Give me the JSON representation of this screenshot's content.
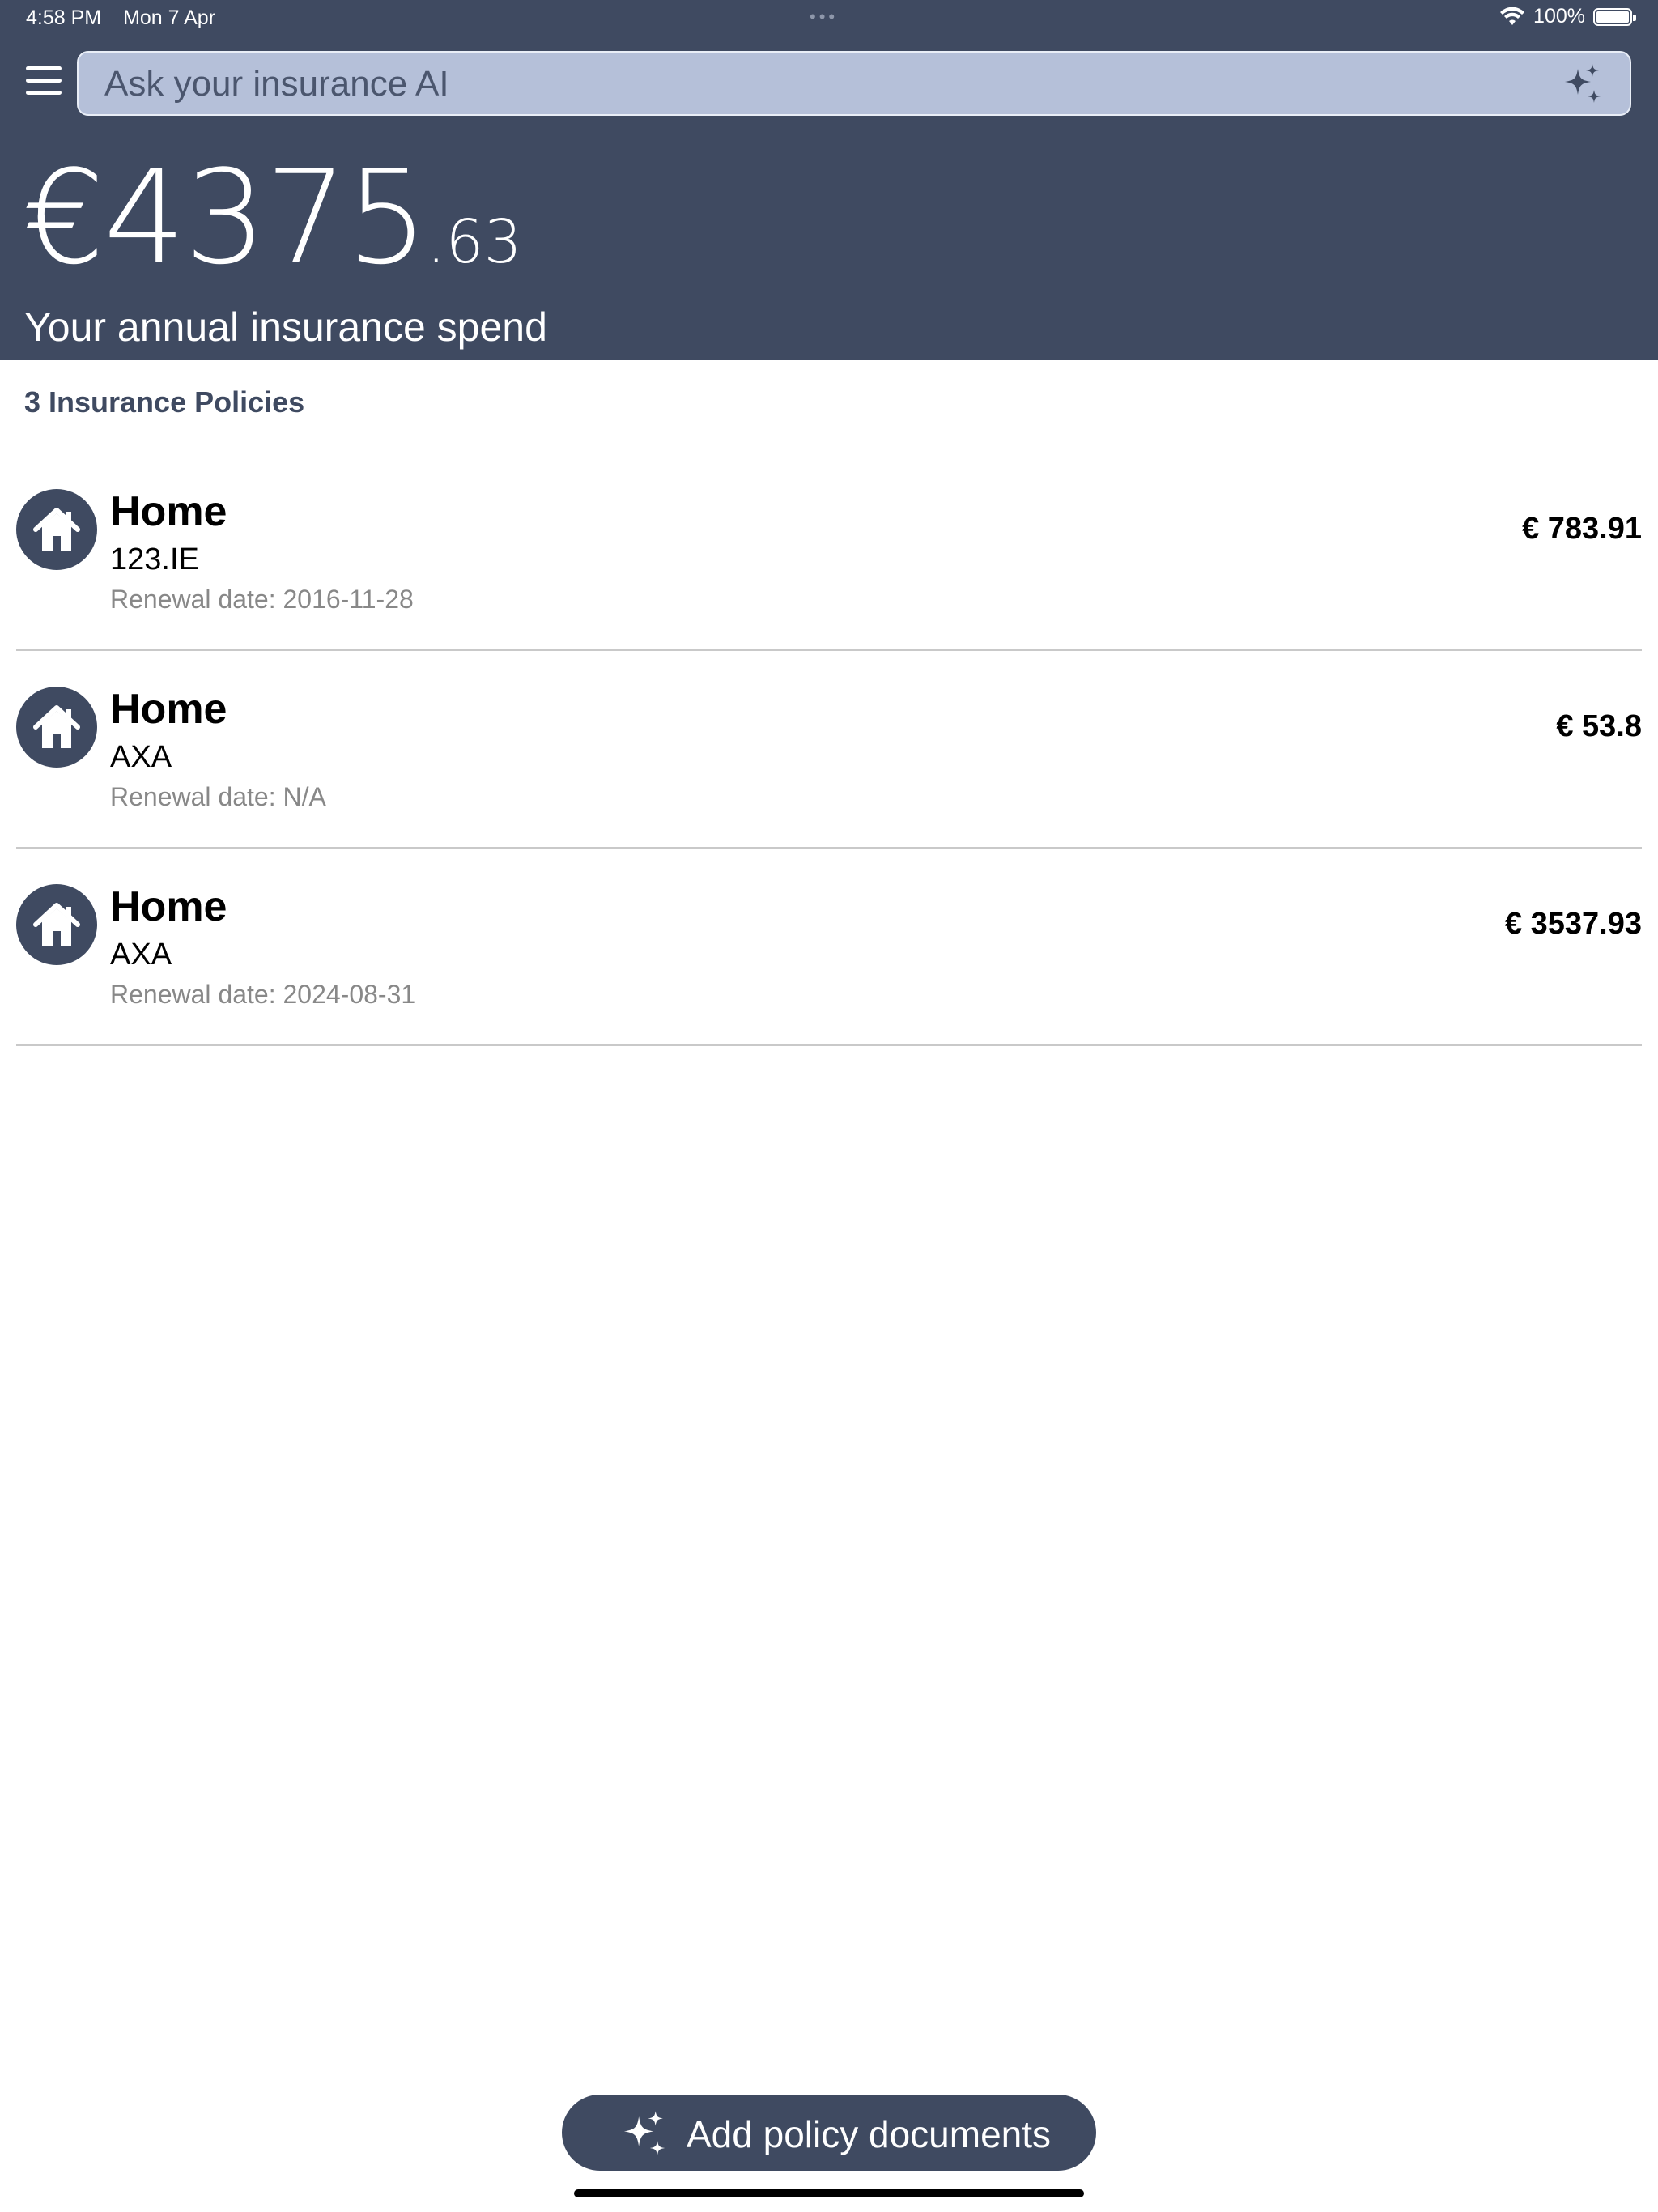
{
  "status_bar": {
    "time": "4:58 PM",
    "date": "Mon 7 Apr",
    "battery": "100%"
  },
  "search": {
    "placeholder": "Ask your insurance AI"
  },
  "summary": {
    "amount_main": "€4375",
    "amount_decimal": ".63",
    "subtitle": "Your annual insurance spend"
  },
  "policies": {
    "count_label": "3 Insurance Policies",
    "items": [
      {
        "type": "Home",
        "insurer": "123.IE",
        "renewal": "Renewal date: 2016-11-28",
        "price": "€  783.91"
      },
      {
        "type": "Home",
        "insurer": "AXA",
        "renewal": "Renewal date: N/A",
        "price": "€  53.8"
      },
      {
        "type": "Home",
        "insurer": "AXA",
        "renewal": "Renewal date: 2024-08-31",
        "price": "€  3537.93"
      }
    ]
  },
  "actions": {
    "add_label": "Add policy documents"
  },
  "colors": {
    "header": "#3f4a61",
    "search_bg": "#b5c0d9"
  }
}
